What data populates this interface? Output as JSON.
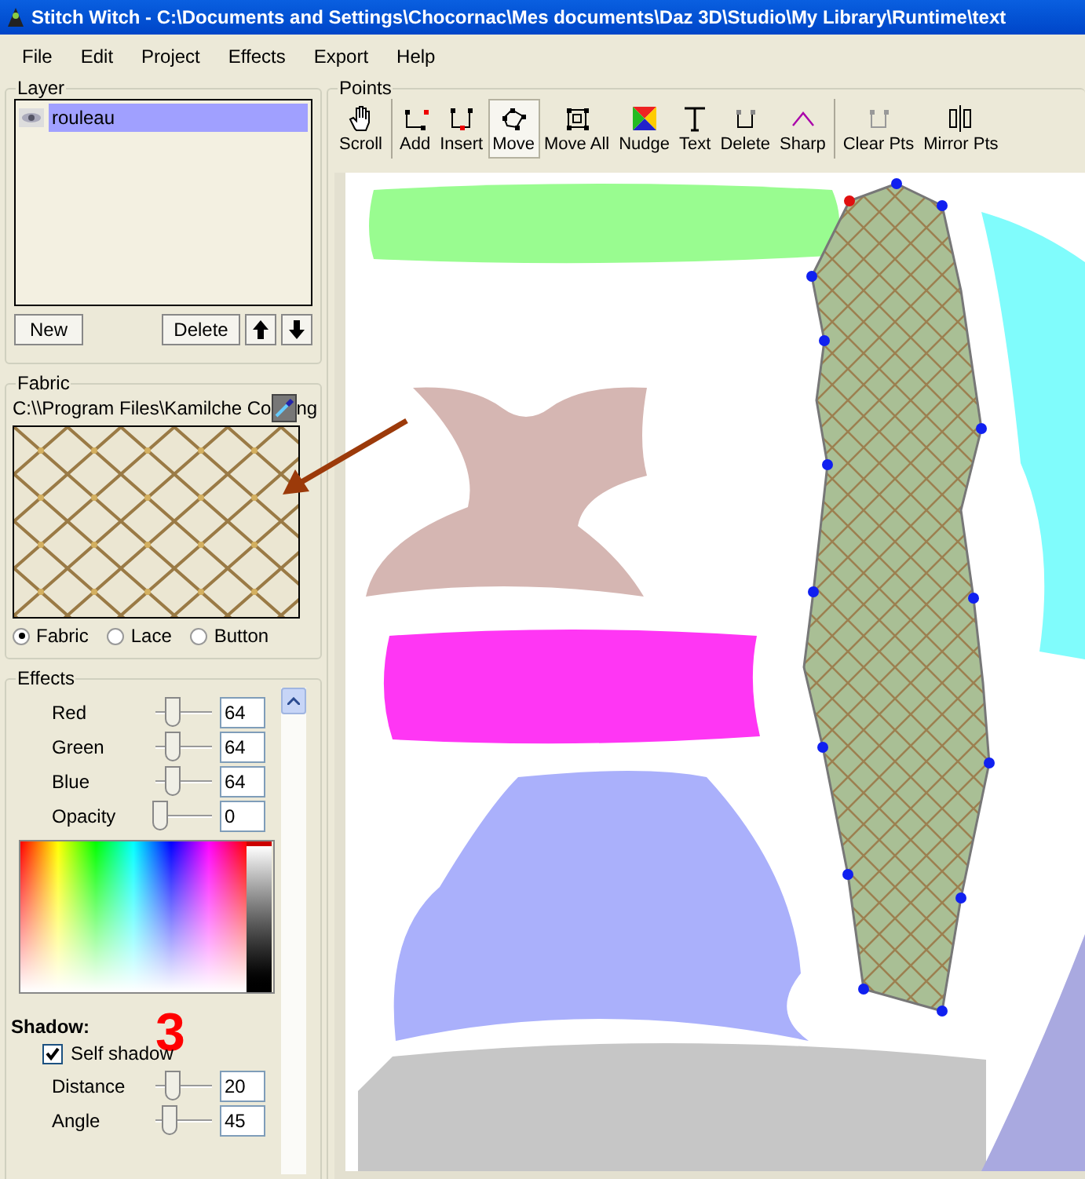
{
  "window": {
    "title": "Stitch Witch - C:\\Documents and Settings\\Chocornac\\Mes documents\\Daz 3D\\Studio\\My Library\\Runtime\\text"
  },
  "menu": [
    "File",
    "Edit",
    "Project",
    "Effects",
    "Export",
    "Help"
  ],
  "layer": {
    "title": "Layer",
    "items": [
      {
        "name": "rouleau",
        "selected": true,
        "visible": true
      }
    ],
    "buttons": [
      "New",
      "Delete"
    ]
  },
  "fabric": {
    "title": "Fabric",
    "path": "C:\\\\Program  Files\\Kamilche  Co",
    "path_end": "ng",
    "options": [
      {
        "label": "Fabric",
        "selected": true
      },
      {
        "label": "Lace",
        "selected": false
      },
      {
        "label": "Button",
        "selected": false
      }
    ]
  },
  "effects": {
    "title": "Effects",
    "sliders": [
      {
        "label": "Red",
        "value": "64",
        "level": 0.25
      },
      {
        "label": "Green",
        "value": "64",
        "level": 0.25
      },
      {
        "label": "Blue",
        "value": "64",
        "level": 0.25
      },
      {
        "label": "Opacity",
        "value": "0",
        "level": 0
      }
    ],
    "shadow": {
      "title": "Shadow:",
      "self_shadow": {
        "label": "Self shadow",
        "checked": true
      },
      "sliders": [
        {
          "label": "Distance",
          "value": "20",
          "level": 0.25
        },
        {
          "label": "Angle",
          "value": "45",
          "level": 0.2
        }
      ]
    }
  },
  "annotation": {
    "number": "3"
  },
  "toolbar": {
    "title": "Points",
    "groups": [
      [
        {
          "label": "Scroll",
          "selected": false
        }
      ],
      [
        {
          "label": "Add",
          "selected": false
        },
        {
          "label": "Insert",
          "selected": false
        },
        {
          "label": "Move",
          "selected": true
        },
        {
          "label": "Move All",
          "selected": false
        },
        {
          "label": "Nudge",
          "selected": false
        },
        {
          "label": "Text",
          "selected": false
        },
        {
          "label": "Delete",
          "selected": false
        },
        {
          "label": "Sharp",
          "selected": false
        }
      ],
      [
        {
          "label": "Clear Pts",
          "selected": false
        },
        {
          "label": "Mirror Pts",
          "selected": false
        }
      ]
    ]
  }
}
